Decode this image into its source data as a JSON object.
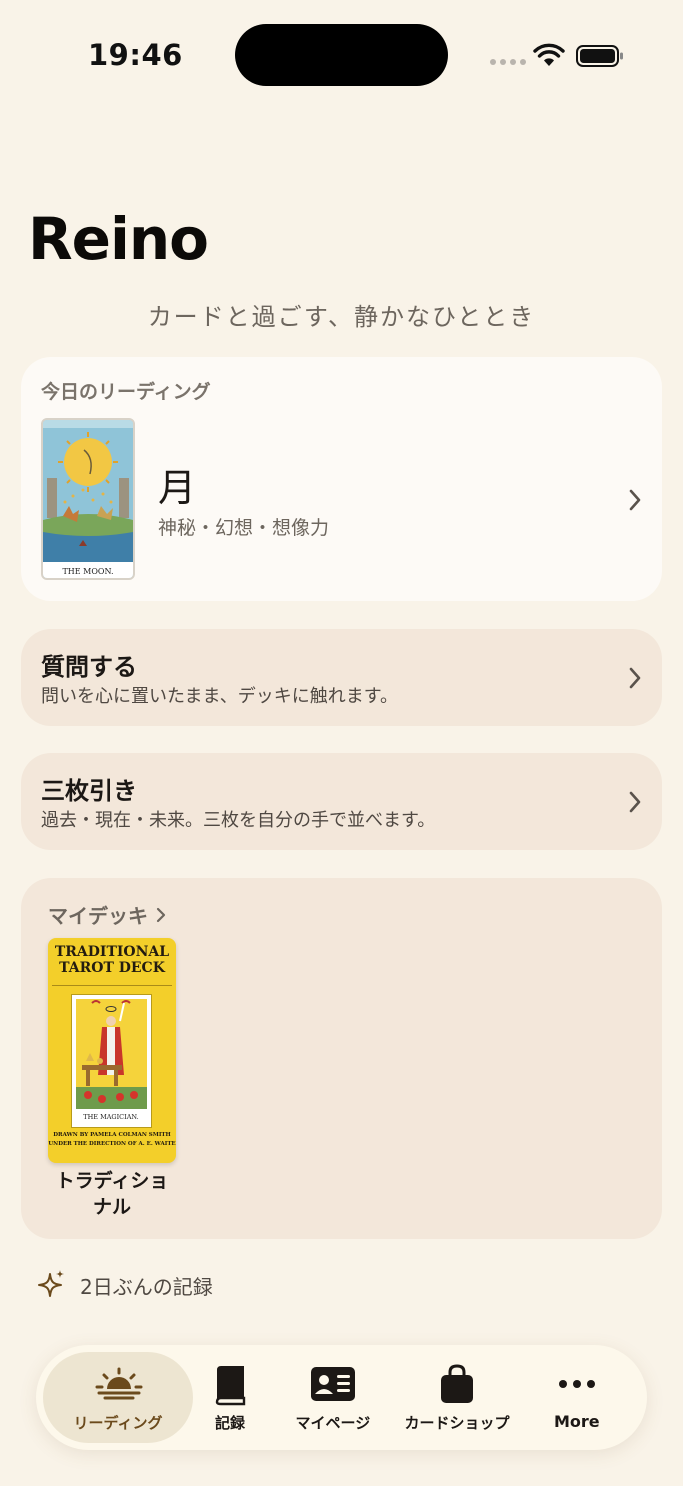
{
  "status": {
    "time": "19:46"
  },
  "app": {
    "title": "Reino",
    "tagline": "カードと過ごす、静かなひととき"
  },
  "today": {
    "label": "今日のリーディング",
    "card_name": "月",
    "keywords": "神秘・幻想・想像力",
    "card_caption": "THE MOON."
  },
  "actions": [
    {
      "title": "質問する",
      "subtitle": "問いを心に置いたまま、デッキに触れます。"
    },
    {
      "title": "三枚引き",
      "subtitle": "過去・現在・未来。三枚を自分の手で並べます。"
    }
  ],
  "deck": {
    "header": "マイデッキ",
    "box_title": "TRADITIONAL\nTAROT DECK",
    "box_card_caption": "THE MAGICIAN.",
    "box_credit": "DRAWN BY PAMELA COLMAN SMITH\nUNDER THE DIRECTION OF A. E. WAITE",
    "name": "トラディショナル"
  },
  "records": {
    "text": "2日ぶんの記録"
  },
  "tabs": [
    {
      "label": "リーディング",
      "icon": "sunrise-icon",
      "active": true
    },
    {
      "label": "記録",
      "icon": "book-icon",
      "active": false
    },
    {
      "label": "マイページ",
      "icon": "id-card-icon",
      "active": false
    },
    {
      "label": "カードショップ",
      "icon": "shopping-bag-icon",
      "active": false
    },
    {
      "label": "More",
      "icon": "more-icon",
      "active": false
    }
  ],
  "colors": {
    "background": "#f9f3e8",
    "card": "#fdfaf6",
    "action_card": "#f3e7da",
    "deck_yellow": "#f3cf2a",
    "tab_active": "#ede5d1",
    "accent_brown": "#6b4a1c"
  }
}
